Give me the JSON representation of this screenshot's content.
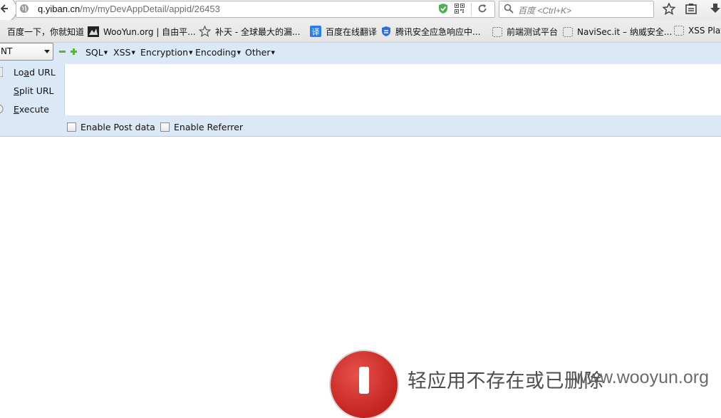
{
  "address_bar": {
    "host": "q.yiban.cn",
    "path": "/my/myDevAppDetail/appid/26453"
  },
  "search_bar": {
    "placeholder": "百度 <Ctrl+K>"
  },
  "bookmarks": [
    {
      "label": "百度一下，你就知道",
      "icon": "baidu-icon"
    },
    {
      "label": "WooYun.org | 自由平...",
      "icon": "wooyun-icon"
    },
    {
      "label": "补天 - 全球最大的漏...",
      "icon": "butian-star-icon"
    },
    {
      "label": "百度在线翻译",
      "icon": "translate-icon"
    },
    {
      "label": "腾讯安全应急响应中...",
      "icon": "tencent-shield-icon"
    },
    {
      "label": "前端测试平台",
      "icon": "page-icon"
    },
    {
      "label": "NaviSec.it – 纳威安全...",
      "icon": "page-icon"
    },
    {
      "label": "XSS Plat",
      "icon": "page-icon"
    }
  ],
  "hackbar": {
    "select_value": "NT",
    "menus": [
      "SQL",
      "XSS",
      "Encryption",
      "Encoding",
      "Other"
    ],
    "buttons": {
      "load_prefix": "Lo",
      "load_accel": "a",
      "load_rest": "d URL",
      "split_accel": "S",
      "split_rest": "plit URL",
      "execute_accel": "E",
      "execute_rest": "xecute"
    },
    "options": [
      "Enable Post data",
      "Enable Referrer"
    ]
  },
  "page": {
    "error_message": "轻应用不存在或已删除",
    "watermark": "www.wooyun.org"
  },
  "colors": {
    "hackbar_bg": "#dbe8f6",
    "error_red": "#d0302b"
  }
}
